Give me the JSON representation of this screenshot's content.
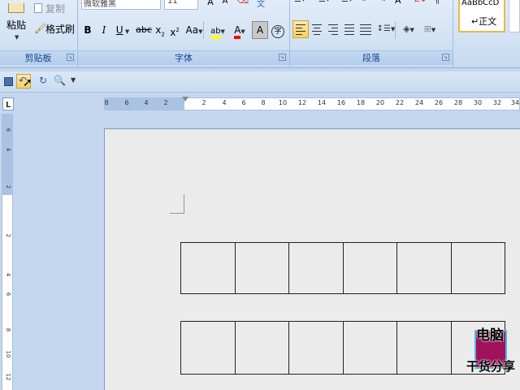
{
  "clipboard": {
    "paste_label": "粘贴",
    "copy_label": "复制",
    "format_painter_label": "格式刷",
    "group_label": "剪贴板"
  },
  "font": {
    "font_name": "微软雅黑",
    "font_size": "11",
    "bold": "B",
    "italic": "I",
    "underline": "U",
    "strikethrough": "abc",
    "subscript": "x",
    "superscript": "x",
    "change_case": "Aa",
    "highlight": "ab",
    "font_color": "A",
    "char_shading": "A",
    "phonetic": "字",
    "group_label": "字体"
  },
  "paragraph": {
    "group_label": "段落"
  },
  "styles": {
    "style_preview": "AaBbCcD",
    "style_name": "↵正文"
  },
  "ruler": {
    "horizontal_ticks": [
      "8",
      "6",
      "4",
      "2",
      "2",
      "4",
      "6",
      "8",
      "10",
      "12",
      "14",
      "16",
      "18",
      "20",
      "22",
      "24",
      "26",
      "28",
      "30",
      "32",
      "34"
    ],
    "vertical_ticks": [
      "6",
      "4",
      "2",
      "2",
      "4",
      "6",
      "8",
      "10",
      "12"
    ],
    "tab_selector": "L"
  },
  "watermark": {
    "line1": "电脑",
    "line2": "干货分享"
  },
  "colors": {
    "accent": "#15428b",
    "highlight_yellow": "#ffff00",
    "font_red": "#ff0000",
    "ribbon_bg": "#d4e3f5",
    "page_bg": "#ebebeb"
  }
}
